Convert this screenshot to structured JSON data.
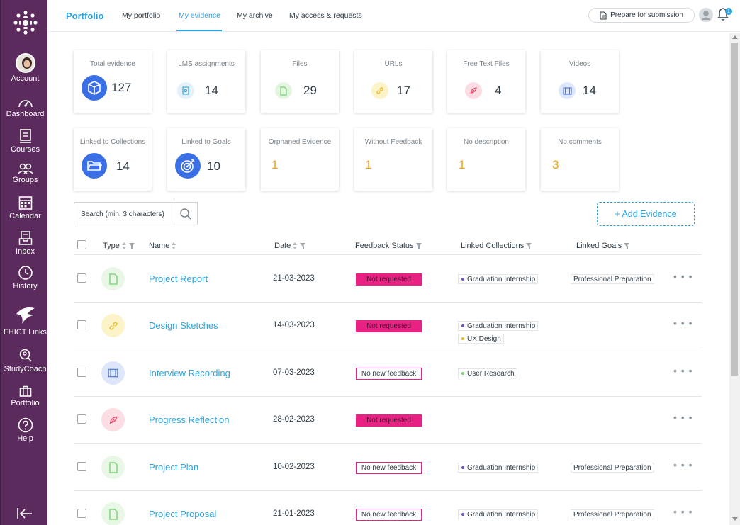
{
  "nav": {
    "items": [
      {
        "label": "Account",
        "icon": "avatar"
      },
      {
        "label": "Dashboard",
        "icon": "dashboard-icon"
      },
      {
        "label": "Courses",
        "icon": "courses-icon"
      },
      {
        "label": "Groups",
        "icon": "groups-icon"
      },
      {
        "label": "Calendar",
        "icon": "calendar-icon"
      },
      {
        "label": "Inbox",
        "icon": "inbox-icon"
      },
      {
        "label": "History",
        "icon": "history-icon"
      },
      {
        "label": "FHICT Links",
        "icon": "fhict-links-icon"
      },
      {
        "label": "StudyCoach",
        "icon": "studycoach-icon"
      },
      {
        "label": "Portfolio",
        "icon": "portfolio-icon"
      },
      {
        "label": "Help",
        "icon": "help-icon"
      }
    ]
  },
  "topbar": {
    "brand": "Portfolio",
    "tabs": [
      "My portfolio",
      "My evidence",
      "My archive",
      "My access & requests"
    ],
    "active_tab": "My evidence",
    "prepare_label": "Prepare for submission",
    "notification_count": "1"
  },
  "stats_row1": [
    {
      "title": "Total evidence",
      "value": "127",
      "icon": "cube-icon"
    },
    {
      "title": "LMS assignments",
      "value": "14",
      "icon": "assignment-icon"
    },
    {
      "title": "Files",
      "value": "29",
      "icon": "file-icon"
    },
    {
      "title": "URLs",
      "value": "17",
      "icon": "link-icon"
    },
    {
      "title": "Free Text Files",
      "value": "4",
      "icon": "feather-icon"
    },
    {
      "title": "Videos",
      "value": "14",
      "icon": "film-icon"
    }
  ],
  "stats_row2": [
    {
      "title": "Linked to Collections",
      "value": "14",
      "icon": "folder-icon"
    },
    {
      "title": "Linked to Goals",
      "value": "10",
      "icon": "target-icon"
    },
    {
      "title": "Orphaned Evidence",
      "value": "1"
    },
    {
      "title": "Without Feedback",
      "value": "1"
    },
    {
      "title": "No description",
      "value": "1"
    },
    {
      "title": "No comments",
      "value": "3"
    }
  ],
  "search": {
    "placeholder": "Search (min. 3 characters)"
  },
  "add_button": "+ Add Evidence",
  "table": {
    "columns": [
      "Type",
      "Name",
      "Date",
      "Feedback Status",
      "Linked Collections",
      "Linked Goals"
    ],
    "rows": [
      {
        "type": "file",
        "name": "Project Report",
        "date": "21-03-2023",
        "feedback": "Not requested",
        "collections": [
          "Graduation Internship"
        ],
        "goal": "Professional Preparation"
      },
      {
        "type": "url",
        "name": "Design Sketches",
        "date": "14-03-2023",
        "feedback": "Not requested",
        "collections": [
          "Graduation Internship",
          "UX Design"
        ],
        "goal": ""
      },
      {
        "type": "video",
        "name": "Interview Recording",
        "date": "07-03-2023",
        "feedback": "No new feedback",
        "collections": [
          "User Research"
        ],
        "goal": ""
      },
      {
        "type": "text",
        "name": "Progress Reflection",
        "date": "28-02-2023",
        "feedback": "Not requested",
        "collections": [],
        "goal": ""
      },
      {
        "type": "file",
        "name": "Project Plan",
        "date": "10-02-2023",
        "feedback": "No new feedback",
        "collections": [
          "Graduation Internship"
        ],
        "goal": "Professional Preparation"
      },
      {
        "type": "file",
        "name": "Project Proposal",
        "date": "21-01-2023",
        "feedback": "No new feedback",
        "collections": [
          "Graduation Internship"
        ],
        "goal": "Professional Preparation"
      }
    ],
    "more_label": "• • •"
  },
  "colors": {
    "accent": "#2aa3de",
    "sidebar": "#5b2b5e",
    "feedback_magenta": "#e72283",
    "warning_orange": "#e8a320"
  }
}
